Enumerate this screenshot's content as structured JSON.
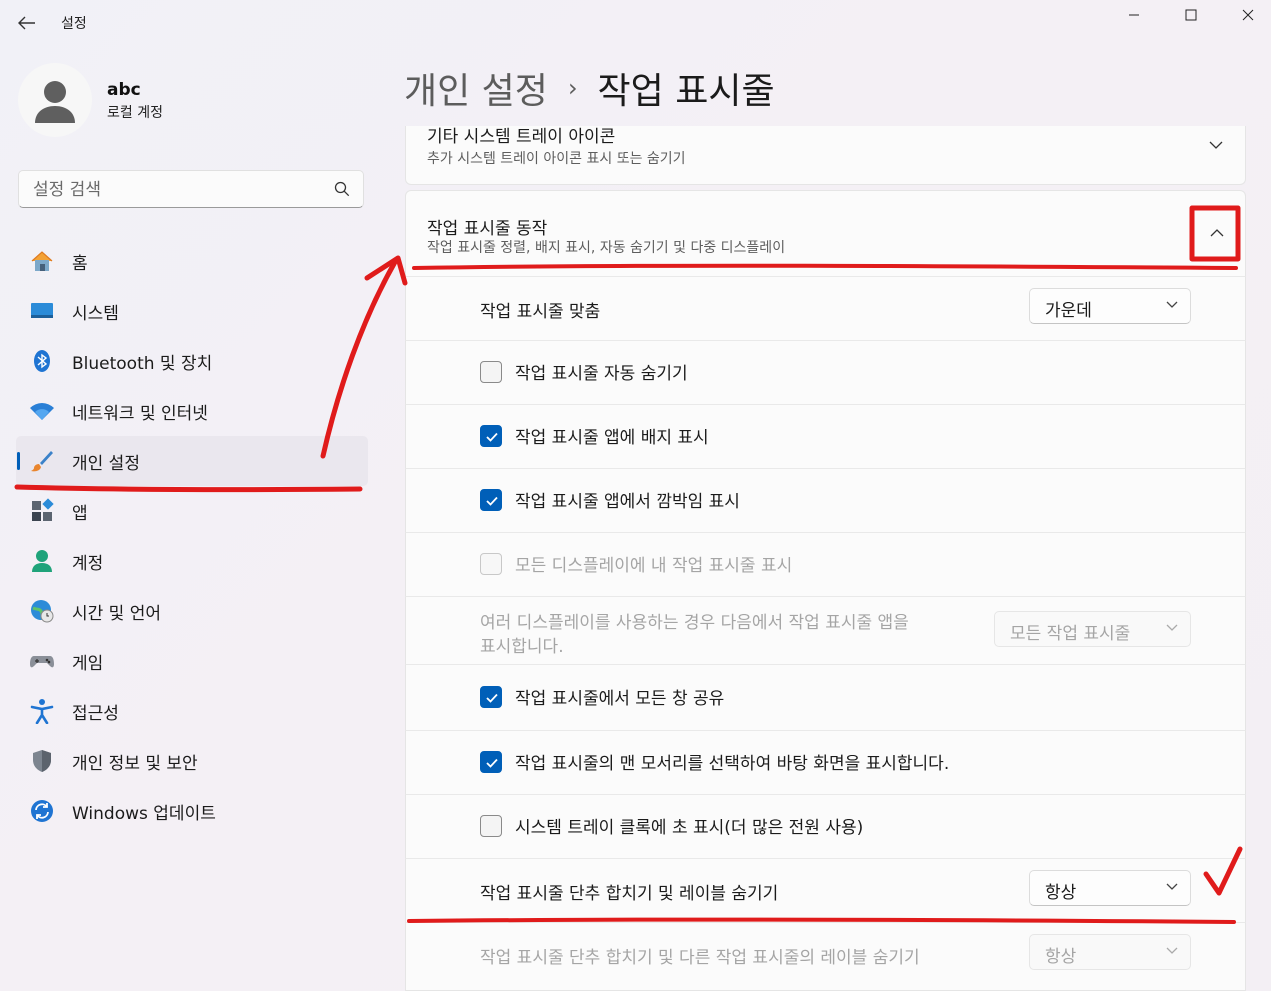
{
  "window": {
    "title": "설정",
    "back_icon": "arrow-left-icon",
    "controls": [
      "minimize-icon",
      "maximize-icon",
      "close-icon"
    ]
  },
  "user": {
    "name": "abc",
    "account_type": "로컬 계정"
  },
  "search": {
    "placeholder": "설정 검색"
  },
  "nav": {
    "items": [
      {
        "label": "홈",
        "icon": "home-icon"
      },
      {
        "label": "시스템",
        "icon": "monitor-icon"
      },
      {
        "label": "Bluetooth 및 장치",
        "icon": "bluetooth-icon"
      },
      {
        "label": "네트워크 및 인터넷",
        "icon": "wifi-icon"
      },
      {
        "label": "개인 설정",
        "icon": "paintbrush-icon",
        "selected": true
      },
      {
        "label": "앱",
        "icon": "apps-icon"
      },
      {
        "label": "계정",
        "icon": "person-icon"
      },
      {
        "label": "시간 및 언어",
        "icon": "globe-clock-icon"
      },
      {
        "label": "게임",
        "icon": "gamepad-icon"
      },
      {
        "label": "접근성",
        "icon": "accessibility-icon"
      },
      {
        "label": "개인 정보 및 보안",
        "icon": "shield-icon"
      },
      {
        "label": "Windows 업데이트",
        "icon": "update-icon"
      }
    ]
  },
  "breadcrumb": {
    "parent": "개인 설정",
    "separator": "›",
    "current": "작업 표시줄"
  },
  "sections": {
    "tray_icons": {
      "title": "기타 시스템 트레이 아이콘",
      "subtitle": "추가 시스템 트레이 아이콘 표시 또는 숨기기",
      "expanded": false
    },
    "behaviors": {
      "title": "작업 표시줄 동작",
      "subtitle": "작업 표시줄 정렬, 배지 표시, 자동 숨기기 및 다중 디스플레이",
      "expanded": true,
      "alignment": {
        "label": "작업 표시줄 맞춤",
        "value": "가운데"
      },
      "auto_hide": {
        "label": "작업 표시줄 자동 숨기기",
        "checked": false
      },
      "badges": {
        "label": "작업 표시줄 앱에 배지 표시",
        "checked": true
      },
      "flashing": {
        "label": "작업 표시줄 앱에서 깜박임 표시",
        "checked": true
      },
      "all_displays": {
        "label": "모든 디스플레이에 내 작업 표시줄 표시",
        "checked": false,
        "disabled": true
      },
      "multi_display_apps": {
        "label_line1": "여러 디스플레이를 사용하는 경우 다음에서 작업 표시줄 앱을",
        "label_line2": "표시합니다.",
        "value": "모든 작업 표시줄",
        "disabled": true
      },
      "share_window": {
        "label": "작업 표시줄에서 모든 창 공유",
        "checked": true
      },
      "far_corner": {
        "label": "작업 표시줄의 맨 모서리를 선택하여 바탕 화면을 표시합니다.",
        "checked": true
      },
      "seconds_clock": {
        "label": "시스템 트레이 클록에 초 표시(더 많은 전원 사용)",
        "checked": false
      },
      "combine_buttons": {
        "label": "작업 표시줄 단추 합치기 및 레이블 숨기기",
        "value": "항상"
      },
      "combine_other": {
        "label": "작업 표시줄 단추 합치기 및 다른 작업 표시줄의 레이블 숨기기",
        "value": "항상",
        "disabled": true
      }
    }
  },
  "colors": {
    "accent": "#005fb8",
    "annotation": "#e01b1b"
  }
}
